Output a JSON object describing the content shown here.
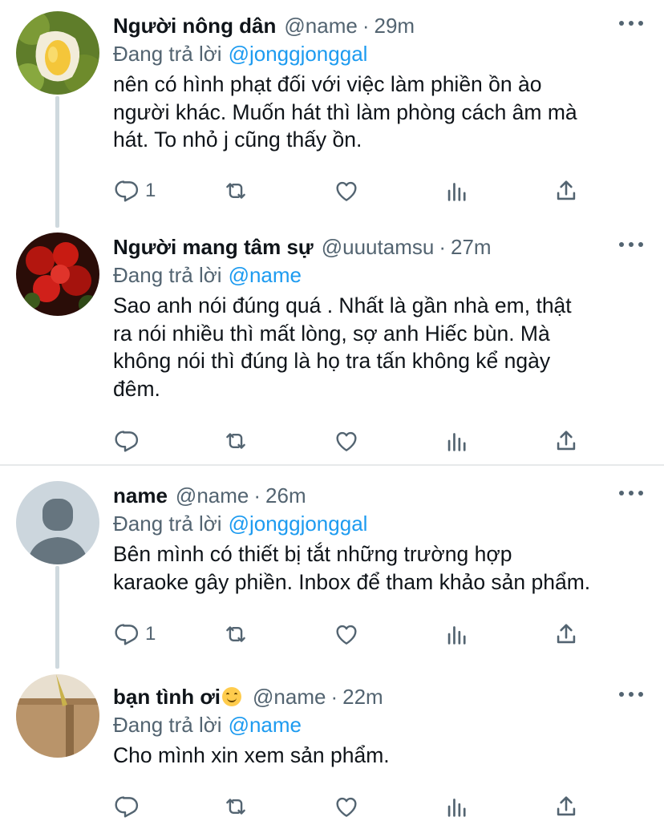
{
  "replying_label": "Đang trả lời",
  "tweets": [
    {
      "display_name": "Người nông dân",
      "handle": "@name",
      "dot": "·",
      "time": "29m",
      "reply_to": "@jonggjonggal",
      "text": "nên có hình phạt đối với việc làm phiền ồn ào\nngười khác. Muốn hát thì làm phòng cách âm mà\nhát. To nhỏ j cũng thấy ồn.",
      "reply_count": "1",
      "avatar_icon": "durian-photo"
    },
    {
      "display_name": "Người mang tâm sự",
      "handle": "@uuutamsu",
      "dot": "·",
      "time": "27m",
      "reply_to": "@name",
      "text": "Sao anh nói đúng quá . Nhất là gần nhà em, thật\nra nói nhiều thì mất lòng, sợ anh Hiếc bùn. Mà\nkhông nói thì đúng là họ tra tấn không kể ngày\nđêm.",
      "reply_count": "",
      "avatar_icon": "red-flower-photo"
    },
    {
      "display_name": "name",
      "handle": "@name",
      "dot": "·",
      "time": "26m",
      "reply_to": "@jonggjonggal",
      "text": "Bên mình có thiết bị tắt những trường hợp\nkaraoke gây phiền. Inbox để tham khảo sản phẩm.",
      "reply_count": "1",
      "avatar_icon": "default-user-icon"
    },
    {
      "display_name": "bạn tình ơi",
      "handle": "@name",
      "dot": "·",
      "time": "22m",
      "reply_to": "@name",
      "text": "Cho mình xin xem sản phẩm.",
      "reply_count": "",
      "avatar_icon": "cardboard-photo"
    }
  ],
  "colors": {
    "accent": "#1d9bf0",
    "secondary_text": "#536471",
    "primary_text": "#0f1419",
    "thread_line": "#cfd9de",
    "divider": "#e7e9ea"
  }
}
